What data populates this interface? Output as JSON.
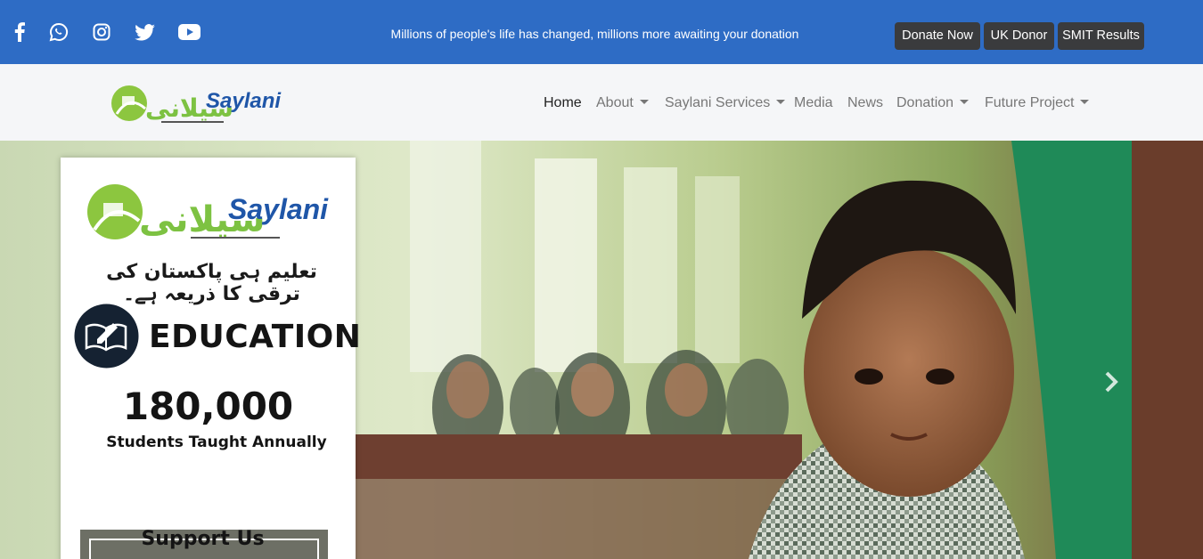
{
  "topbar": {
    "social": [
      {
        "name": "facebook-icon"
      },
      {
        "name": "whatsapp-icon"
      },
      {
        "name": "instagram-icon"
      },
      {
        "name": "twitter-icon"
      },
      {
        "name": "youtube-icon"
      }
    ],
    "tagline": "Millions of people's life has changed, millions more awaiting your donation",
    "buttons": {
      "donate_now": "Donate Now",
      "uk_donor": "UK Donor",
      "smit_results": "SMIT Results"
    },
    "colors": {
      "bar": "#2e6cc5",
      "button": "#3a3b3d"
    }
  },
  "navbar": {
    "logo_text": "Saylani",
    "logo_urdu": "سیلانی",
    "items": {
      "home": "Home",
      "about": "About",
      "services": "Saylani Services",
      "media": "Media",
      "news": "News",
      "donation": "Donation",
      "future": "Future Project"
    }
  },
  "hero": {
    "card": {
      "logo_text": "Saylani",
      "logo_urdu": "سیلانی",
      "urdu_line": "تعلیم ہی پاکستان کی ترقی کا ذریعہ ہے۔",
      "title": "EDUCATION",
      "number": "180,000",
      "caption": "Students Taught Annually",
      "support": "Support Us"
    },
    "next_icon": "chevron-right-icon"
  }
}
